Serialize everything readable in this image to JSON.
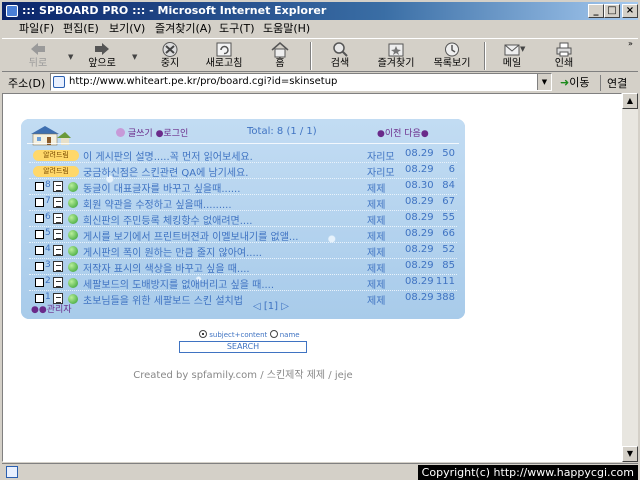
{
  "window": {
    "title": "::: SPBOARD PRO ::: - Microsoft Internet Explorer",
    "min_label": "_",
    "max_label": "□",
    "close_label": "×"
  },
  "menu": [
    "파일(F)",
    "편집(E)",
    "보기(V)",
    "즐겨찾기(A)",
    "도구(T)",
    "도움말(H)"
  ],
  "toolbar": {
    "back": "뒤로",
    "forward": "앞으로",
    "stop": "중지",
    "refresh": "새로고침",
    "home": "홈",
    "search": "검색",
    "favorites": "즐겨찾기",
    "history": "목록보기",
    "mail": "메일",
    "print": "인쇄"
  },
  "address": {
    "label": "주소(D)",
    "url": "http://www.whiteart.pe.kr/pro/board.cgi?id=skinsetup",
    "go": "이동",
    "links": "연결"
  },
  "board": {
    "write_label": "글쓰기 ●로그인",
    "total_label": "Total: 8 (1 / 1)",
    "prevnext_label": "●이전 다음●",
    "notices": [
      {
        "badge": "알려드림",
        "subject": "이 게시판의 설명.....꼭 먼저 읽어보세요.",
        "author": "자리모",
        "date": "08.29",
        "hits": "50"
      },
      {
        "badge": "알려드림",
        "subject": "궁금하신점은 스킨관련 QA에 남기세요.",
        "author": "자리모",
        "date": "08.29",
        "hits": "6"
      }
    ],
    "rows": [
      {
        "no": "8",
        "subject": "동글이 대표글자를 바꾸고 싶을때......",
        "author": "제제",
        "date": "08.30",
        "hits": "84"
      },
      {
        "no": "7",
        "subject": "회원 약관을 수정하고 싶을때.........",
        "author": "제제",
        "date": "08.29",
        "hits": "67"
      },
      {
        "no": "6",
        "subject": "희신판의 주민등록 체킹항수 없애려면....",
        "author": "제제",
        "date": "08.29",
        "hits": "55"
      },
      {
        "no": "5",
        "subject": "게시를 보기에서 프린트버젼과 이멜보내기를 없앨...",
        "author": "제제",
        "date": "08.29",
        "hits": "66"
      },
      {
        "no": "4",
        "subject": "게시판의 폭이 원하는 만큼 줄지 않아여.....",
        "author": "제제",
        "date": "08.29",
        "hits": "52"
      },
      {
        "no": "3",
        "subject": "저작자 표시의 색상을 바꾸고 싶을 때....",
        "author": "제제",
        "date": "08.29",
        "hits": "85"
      },
      {
        "no": "2",
        "subject": "세팔보드의 도배방지를 없애버리고 싶을 때....",
        "author": "제제",
        "date": "08.29",
        "hits": "111"
      },
      {
        "no": "1",
        "subject": "초보님들을 위한 세팔보드 스킨 설치법",
        "author": "제제",
        "date": "08.29",
        "hits": "388"
      }
    ],
    "footer_label": "●●관리자",
    "pager": "◁ [1] ▷"
  },
  "search": {
    "opt1": "subject+content",
    "opt2": "name",
    "button": "SEARCH"
  },
  "credit": "Created by spfamily.com / 스킨제작 제제 / jeje",
  "status": "Copyright(c) http://www.happycgi.com"
}
